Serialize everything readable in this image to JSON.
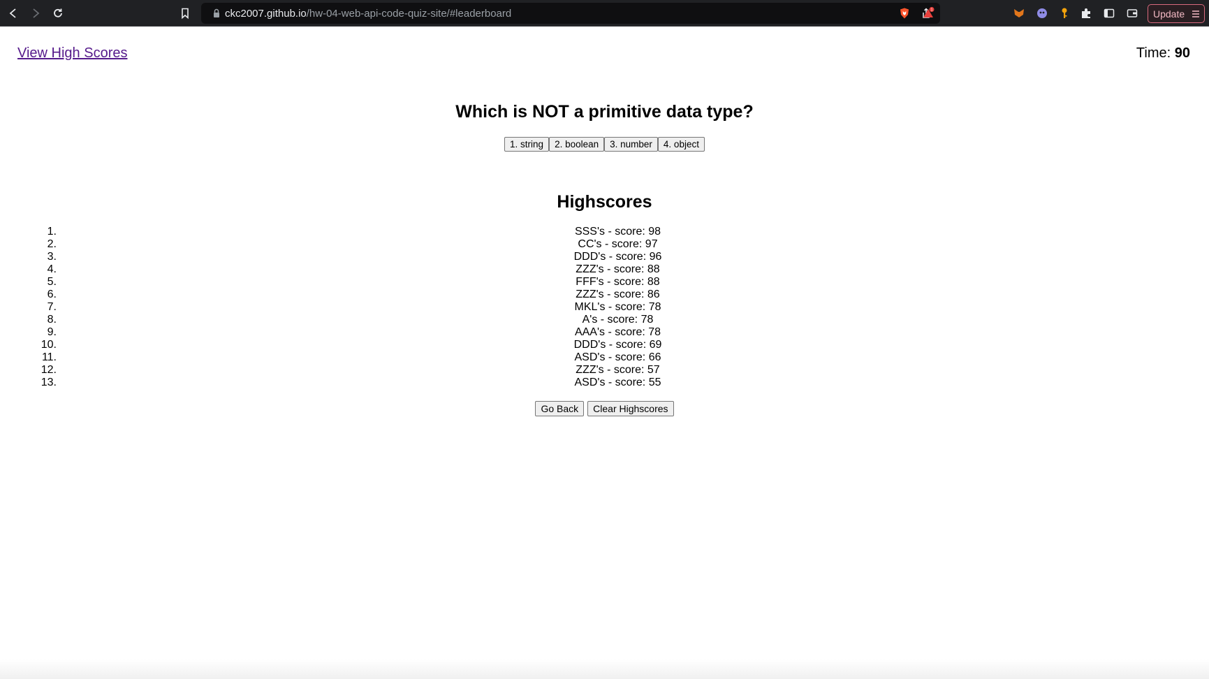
{
  "browser": {
    "url_host": "ckc2007.github.io",
    "url_path": "/hw-04-web-api-code-quiz-site/#leaderboard",
    "update_label": "Update",
    "notification_count": "1",
    "colors": {
      "chrome_bg": "#202124",
      "brave_orange": "#fb542b",
      "update_border": "#d86a7e"
    }
  },
  "header": {
    "view_high_scores": "View High Scores",
    "timer_label": "Time:",
    "timer_value": "90"
  },
  "quiz": {
    "question": "Which is NOT a primitive data type?",
    "choices": [
      "1. string",
      "2. boolean",
      "3. number",
      "4. object"
    ]
  },
  "highscores": {
    "title": "Highscores",
    "entries": [
      {
        "rank": "1.",
        "text": "SSS's - score: 98"
      },
      {
        "rank": "2.",
        "text": "CC's - score: 97"
      },
      {
        "rank": "3.",
        "text": "DDD's - score: 96"
      },
      {
        "rank": "4.",
        "text": "ZZZ's - score: 88"
      },
      {
        "rank": "5.",
        "text": "FFF's - score: 88"
      },
      {
        "rank": "6.",
        "text": "ZZZ's - score: 86"
      },
      {
        "rank": "7.",
        "text": "MKL's - score: 78"
      },
      {
        "rank": "8.",
        "text": "A's - score: 78"
      },
      {
        "rank": "9.",
        "text": "AAA's - score: 78"
      },
      {
        "rank": "10.",
        "text": "DDD's - score: 69"
      },
      {
        "rank": "11.",
        "text": "ASD's - score: 66"
      },
      {
        "rank": "12.",
        "text": "ZZZ's - score: 57"
      },
      {
        "rank": "13.",
        "text": "ASD's - score: 55"
      }
    ],
    "go_back_label": "Go Back",
    "clear_label": "Clear Highscores"
  }
}
